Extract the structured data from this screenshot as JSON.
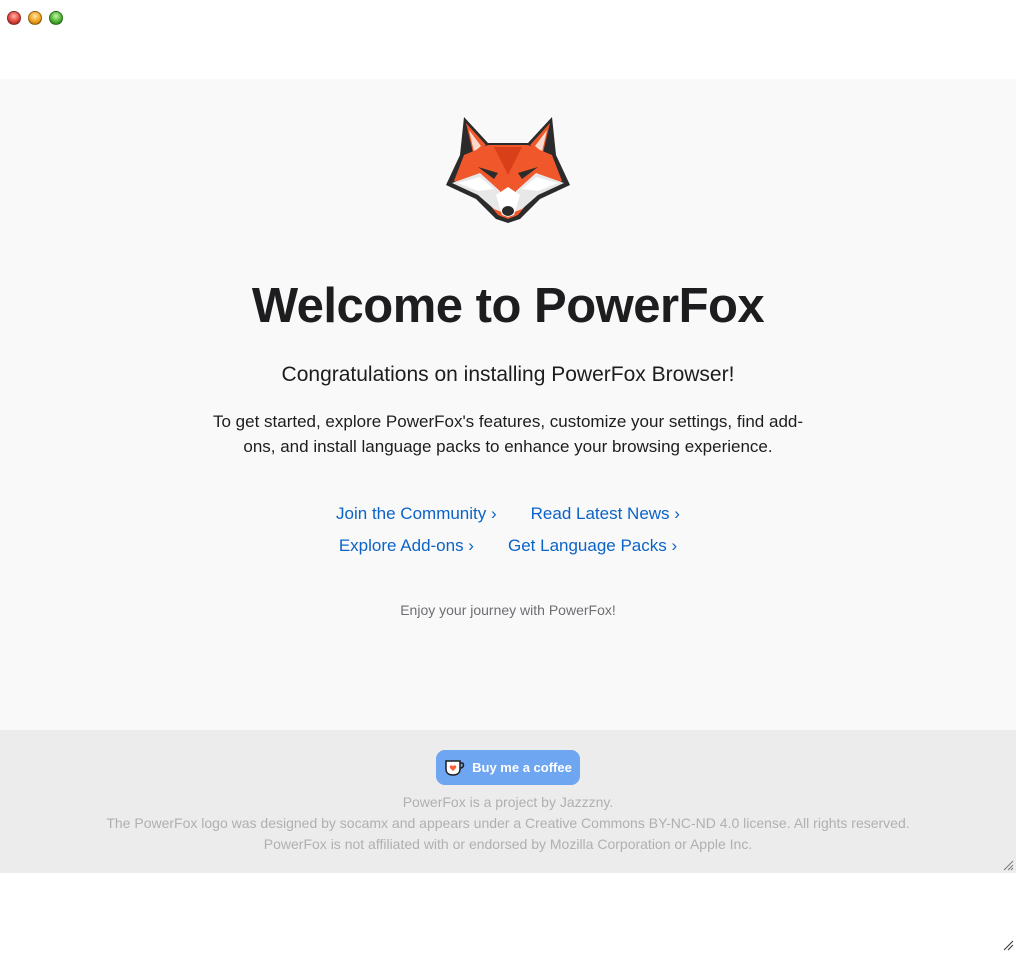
{
  "window": {
    "controls": [
      "close",
      "minimize",
      "zoom"
    ]
  },
  "main": {
    "logo_icon": "fox-head-icon",
    "title": "Welcome to PowerFox",
    "subtitle": "Congratulations on installing PowerFox Browser!",
    "description": "To get started, explore PowerFox's features, customize your settings, find add-ons, and install language packs to enhance your browsing experience.",
    "links": [
      [
        {
          "label": "Join the Community ›"
        },
        {
          "label": "Read Latest News ›"
        }
      ],
      [
        {
          "label": "Explore Add-ons ›"
        },
        {
          "label": "Get Language Packs ›"
        }
      ]
    ],
    "closing": "Enjoy your journey with PowerFox!"
  },
  "footer": {
    "coffee_button_label": "Buy me a coffee",
    "coffee_icon": "coffee-cup-icon",
    "lines": [
      "PowerFox is a project by Jazzzny.",
      "The PowerFox logo was designed by socamx and appears under a Creative Commons BY-NC-ND 4.0 license. All rights reserved.",
      "PowerFox is not affiliated with or endorsed by Mozilla Corporation or Apple Inc."
    ]
  },
  "colors": {
    "link": "#0b63c7",
    "main_bg": "#f9f9f9",
    "footer_bg": "#ececec",
    "button_bg": "#6ea6f2",
    "fox_orange": "#f0572a"
  }
}
